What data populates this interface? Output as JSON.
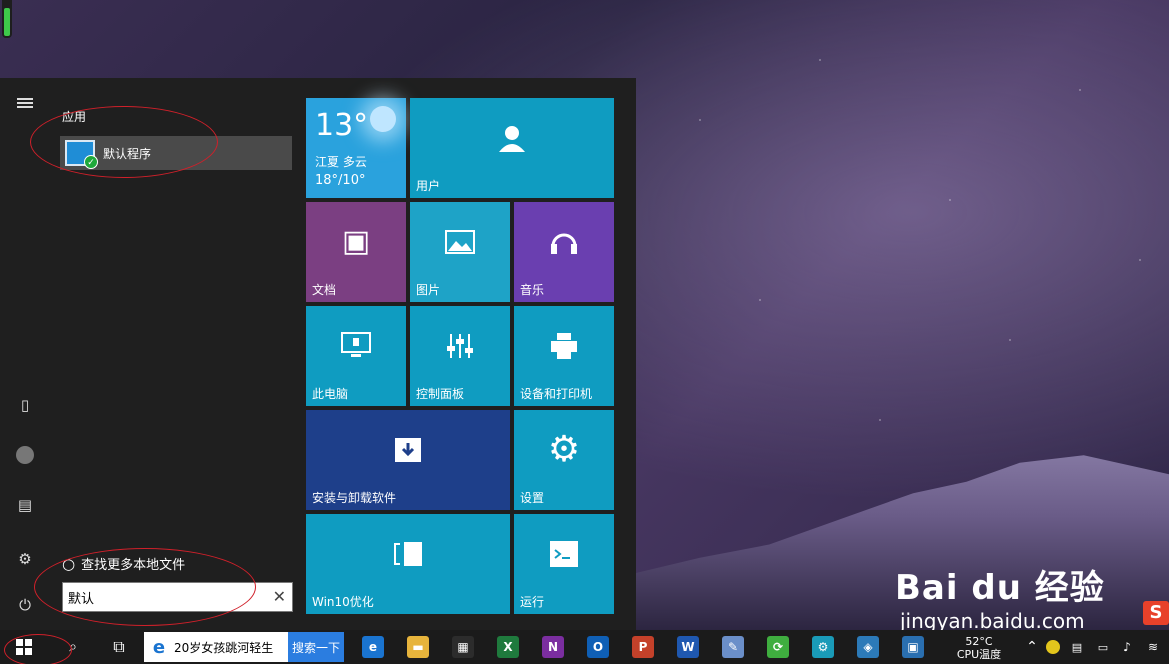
{
  "start_menu": {
    "section_label": "应用",
    "best_match": {
      "label": "默认程序",
      "icon": "default-programs-icon"
    },
    "search_more_label": "查找更多本地文件",
    "search_box": {
      "value": "默认"
    },
    "rail_icons": [
      "hamburger-icon",
      "tablet-mode-icon",
      "user-icon",
      "file-explorer-icon",
      "settings-icon",
      "power-icon"
    ],
    "tiles": [
      {
        "id": "weather",
        "temp": "13°",
        "location": "江夏 多云",
        "range": "18°/10°",
        "color": "#2aa2dd"
      },
      {
        "id": "users",
        "label": "用户",
        "icon": "user-icon",
        "color": "#0f9cc1"
      },
      {
        "id": "documents",
        "label": "文档",
        "icon": "document-icon",
        "color": "#7b3f82"
      },
      {
        "id": "pictures",
        "label": "图片",
        "icon": "picture-icon",
        "color": "#1ea3c7"
      },
      {
        "id": "music",
        "label": "音乐",
        "icon": "headphones-icon",
        "color": "#6a3fb0"
      },
      {
        "id": "this-pc",
        "label": "此电脑",
        "icon": "monitor-icon",
        "color": "#0f9cc1"
      },
      {
        "id": "control-panel",
        "label": "控制面板",
        "icon": "sliders-icon",
        "color": "#0f9cc1"
      },
      {
        "id": "devices",
        "label": "设备和打印机",
        "icon": "printer-icon",
        "color": "#0f9cc1"
      },
      {
        "id": "install",
        "label": "安装与卸载软件",
        "icon": "install-box-icon",
        "color": "#1e3f8a"
      },
      {
        "id": "settings",
        "label": "设置",
        "icon": "gear-icon",
        "color": "#0f9cc1"
      },
      {
        "id": "win10opt",
        "label": "Win10优化",
        "icon": "optimize-icon",
        "color": "#0f9cc1"
      },
      {
        "id": "run",
        "label": "运行",
        "icon": "run-icon",
        "color": "#0f9cc1"
      }
    ]
  },
  "taskbar": {
    "news_text": "20岁女孩跳河轻生",
    "news_button": "搜索一下",
    "apps": [
      {
        "name": "edge-icon",
        "glyph": "e",
        "color": "#1a74d0"
      },
      {
        "name": "file-explorer-icon",
        "glyph": "▬",
        "color": "#e7b43c"
      },
      {
        "name": "store-icon",
        "glyph": "▦",
        "color": "#2c2c2c"
      },
      {
        "name": "excel-icon",
        "glyph": "X",
        "color": "#1f7a3d"
      },
      {
        "name": "onenote-icon",
        "glyph": "N",
        "color": "#7b2ea0"
      },
      {
        "name": "outlook-icon",
        "glyph": "O",
        "color": "#0f5fb5"
      },
      {
        "name": "powerpoint-icon",
        "glyph": "P",
        "color": "#c4412a"
      },
      {
        "name": "word-icon",
        "glyph": "W",
        "color": "#1f58b0"
      },
      {
        "name": "paint-icon",
        "glyph": "✎",
        "color": "#6b8fc9"
      },
      {
        "name": "refresh-app-icon",
        "glyph": "⟳",
        "color": "#3fae3f"
      },
      {
        "name": "settings-app-icon",
        "glyph": "⚙",
        "color": "#1a9bb8"
      },
      {
        "name": "tool-app-icon",
        "glyph": "◈",
        "color": "#2c7ab8"
      },
      {
        "name": "network-app-icon",
        "glyph": "▣",
        "color": "#2a6fb0"
      }
    ],
    "cpu_temp": "52°C",
    "cpu_label": "CPU温度"
  },
  "watermark": {
    "brand": "Bai du 经验",
    "url": "jingyan.baidu.com",
    "sogou": "S"
  },
  "cpu_gauge_level_percent": 82
}
